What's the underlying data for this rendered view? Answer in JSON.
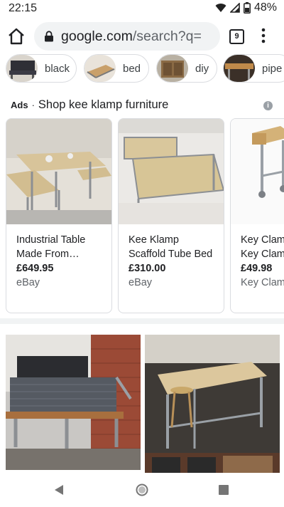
{
  "status": {
    "time": "22:15",
    "battery": "48%"
  },
  "browser": {
    "url_host": "google.com",
    "url_path": "/search?q=",
    "tab_count": "9"
  },
  "chips": [
    {
      "label": "black"
    },
    {
      "label": "bed"
    },
    {
      "label": "diy"
    },
    {
      "label": "pipe"
    }
  ],
  "ads": {
    "label": "Ads",
    "separator": "·",
    "title": "Shop kee klamp furniture",
    "info_icon": "i"
  },
  "products": [
    {
      "title_1": "Industrial Table",
      "title_2": "Made From…",
      "price": "£649.95",
      "seller": "eBay"
    },
    {
      "title_1": "Kee Klamp",
      "title_2": "Scaffold Tube Bed",
      "price": "£310.00",
      "seller": "eBay"
    },
    {
      "title_1": "Key Clamp",
      "title_2": "Key Clamp",
      "price": "£49.98",
      "seller": "Key Clamp"
    }
  ],
  "icons": {
    "home": "home-icon",
    "lock": "lock-icon",
    "menu": "more-vert-icon",
    "back": "back-triangle-icon",
    "home_nav": "home-circle-icon",
    "recents": "recents-square-icon",
    "wifi": "wifi-icon",
    "signal": "signal-icon",
    "battery": "battery-icon"
  }
}
